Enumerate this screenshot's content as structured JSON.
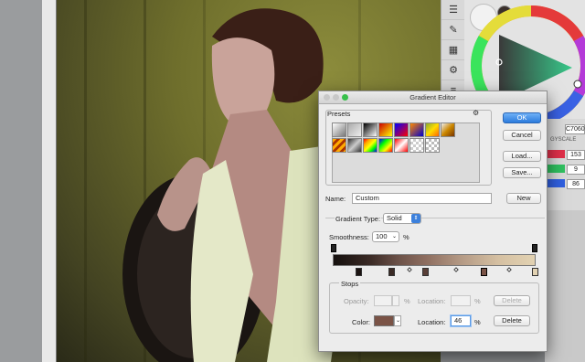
{
  "dialog": {
    "title": "Gradient Editor",
    "presets_label": "Presets",
    "ok_label": "OK",
    "cancel_label": "Cancel",
    "load_label": "Load...",
    "save_label": "Save...",
    "name_label": "Name:",
    "name_value": "Custom",
    "new_label": "New",
    "gradient_type_label": "Gradient Type:",
    "gradient_type_value": "Solid",
    "smoothness_label": "Smoothness:",
    "smoothness_value": "100",
    "percent": "%",
    "stops_label": "Stops",
    "opacity_label": "Opacity:",
    "opacity_location_label": "Location:",
    "delete_label": "Delete",
    "color_label": "Color:",
    "color_value": "#7a5346",
    "color_location_label": "Location:",
    "color_location_value": "46"
  },
  "right_panel": {
    "hex_value": "C7060",
    "values": [
      "153",
      "9",
      "86"
    ],
    "greyscale_label": "GYSCALE"
  }
}
